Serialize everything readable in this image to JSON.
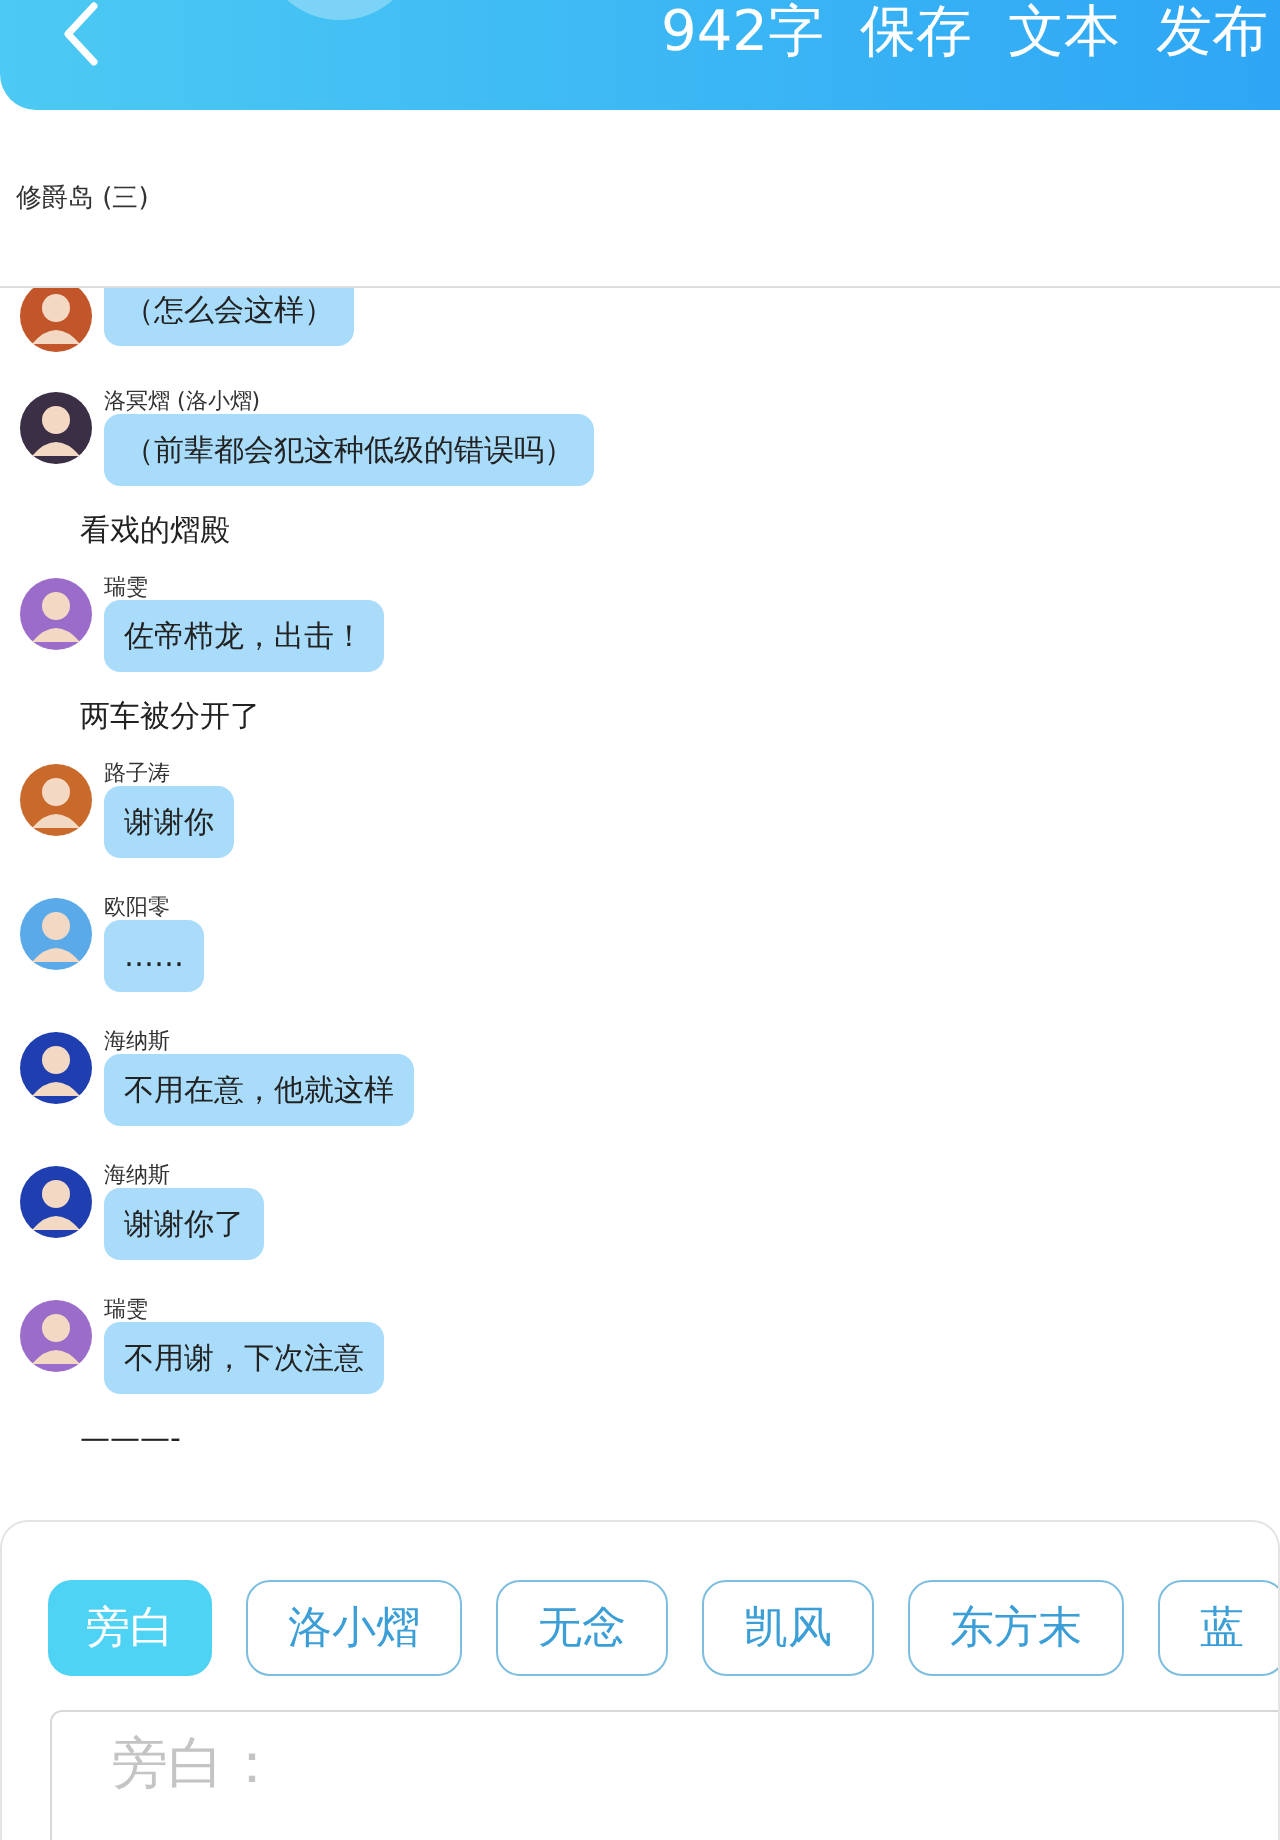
{
  "header": {
    "word_count": "942字",
    "actions": [
      "保存",
      "文本",
      "发布"
    ]
  },
  "chapter_title": "修爵岛 (三)",
  "messages": [
    {
      "kind": "message",
      "color": "#c2562a",
      "text": "（怎么会这样）"
    },
    {
      "kind": "message",
      "color": "#3a2f45",
      "name": "洛冥熠 (洛小熠)",
      "text": "（前辈都会犯这种低级的错误吗）"
    },
    {
      "kind": "narration",
      "text": "看戏的熠殿"
    },
    {
      "kind": "message",
      "color": "#9b6cc9",
      "name": "瑞雯",
      "text": "佐帝栉龙，出击！"
    },
    {
      "kind": "narration",
      "text": "两车被分开了"
    },
    {
      "kind": "message",
      "color": "#c96a2a",
      "name": "路子涛",
      "text": "谢谢你"
    },
    {
      "kind": "message",
      "color": "#5aa9e8",
      "name": "欧阳零",
      "text": "……"
    },
    {
      "kind": "message",
      "color": "#1f3fb0",
      "name": "海纳斯",
      "text": "不用在意，他就这样"
    },
    {
      "kind": "message",
      "color": "#1f3fb0",
      "name": "海纳斯",
      "text": "谢谢你了"
    },
    {
      "kind": "message",
      "color": "#9b6cc9",
      "name": "瑞雯",
      "text": "不用谢，下次注意"
    },
    {
      "kind": "narration",
      "text": "———-"
    }
  ],
  "roles": [
    {
      "label": "旁白",
      "selected": true
    },
    {
      "label": "洛小熠",
      "selected": false
    },
    {
      "label": "无念",
      "selected": false
    },
    {
      "label": "凯风",
      "selected": false
    },
    {
      "label": "东方末",
      "selected": false
    },
    {
      "label": "蓝",
      "selected": false
    }
  ],
  "input": {
    "placeholder": "旁白："
  }
}
